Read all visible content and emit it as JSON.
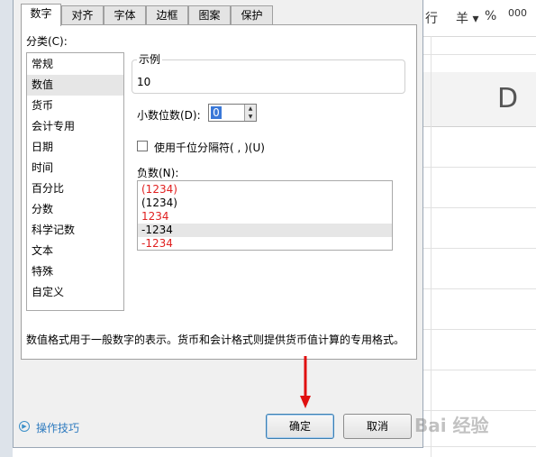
{
  "background": {
    "toolbar": {
      "partial_left": "行",
      "currency": "羊 ▾",
      "percent": "%",
      "thousands": "000"
    },
    "column_header": "D"
  },
  "dialog": {
    "tabs": [
      {
        "label": "数字",
        "active": true
      },
      {
        "label": "对齐",
        "active": false
      },
      {
        "label": "字体",
        "active": false
      },
      {
        "label": "边框",
        "active": false
      },
      {
        "label": "图案",
        "active": false
      },
      {
        "label": "保护",
        "active": false
      }
    ],
    "category_label": "分类(C):",
    "categories": [
      "常规",
      "数值",
      "货币",
      "会计专用",
      "日期",
      "时间",
      "百分比",
      "分数",
      "科学记数",
      "文本",
      "特殊",
      "自定义"
    ],
    "selected_category": "数值",
    "sample": {
      "legend": "示例",
      "value": "10"
    },
    "decimal_places": {
      "label": "小数位数(D):",
      "value": "0"
    },
    "thousand_separator": {
      "label": "使用千位分隔符( , )(U)",
      "checked": false
    },
    "negative": {
      "label": "负数(N):",
      "options": [
        {
          "text": "(1234)",
          "color": "#e02020",
          "selected": false
        },
        {
          "text": "(1234)",
          "color": "#000000",
          "selected": false
        },
        {
          "text": "1234",
          "color": "#e02020",
          "selected": false
        },
        {
          "text": "-1234",
          "color": "#000000",
          "selected": true
        },
        {
          "text": "-1234",
          "color": "#e02020",
          "selected": false
        }
      ]
    },
    "description": "数值格式用于一般数字的表示。货币和会计格式则提供货币值计算的专用格式。",
    "tips_label": "操作技巧",
    "ok_label": "确定",
    "cancel_label": "取消"
  },
  "annotation": {
    "arrow_color": "#e01010"
  },
  "watermark": "Bai 经验"
}
